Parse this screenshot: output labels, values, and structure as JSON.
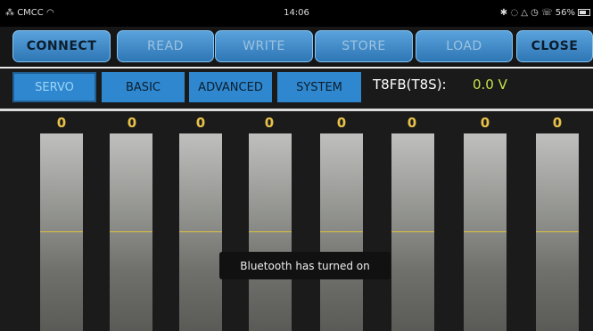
{
  "status": {
    "carrier": "CMCC",
    "time": "14:06",
    "battery": "56%",
    "icons": [
      "signal-icon",
      "wifi-icon",
      "bluetooth-icon",
      "headset-icon",
      "alarm-icon",
      "clock-icon",
      "vibrate-icon",
      "battery-icon"
    ]
  },
  "toolbar": {
    "buttons": [
      "CONNECT",
      "READ",
      "WRITE",
      "STORE",
      "LOAD",
      "CLOSE"
    ]
  },
  "tabs": {
    "items": [
      "SERVO",
      "BASIC",
      "ADVANCED",
      "SYSTEM"
    ],
    "selected": "SERVO"
  },
  "voltage": {
    "label": "T8FB(T8S):",
    "value": "0.0 V"
  },
  "channels": {
    "values": [
      "0",
      "0",
      "0",
      "0",
      "0",
      "0",
      "0",
      "0"
    ]
  },
  "toast": {
    "message": "Bluetooth has turned on"
  },
  "colors": {
    "accent": "#2f88cf",
    "value_text": "#e8c24a",
    "voltage_value": "#c6e24b",
    "center_line": "#e0c240"
  }
}
